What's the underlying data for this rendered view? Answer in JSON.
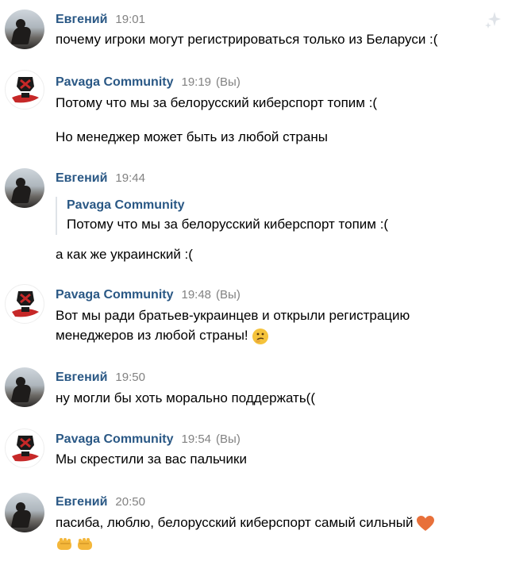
{
  "messages": [
    {
      "author": "Евгений",
      "time": "19:01",
      "owner_tag": "",
      "lines": [
        "почему игроки могут регистрироваться только из Беларуси :("
      ]
    },
    {
      "author": "Pavaga Community",
      "time": "19:19",
      "owner_tag": "(Вы)",
      "lines": [
        "Потому что мы за белорусский киберспорт топим :(",
        "Но менеджер может быть из любой страны"
      ]
    },
    {
      "author": "Евгений",
      "time": "19:44",
      "owner_tag": "",
      "quote": {
        "author": "Pavaga Community",
        "text": "Потому что мы за белорусский киберспорт топим :("
      },
      "lines": [
        "а как же украинский :("
      ]
    },
    {
      "author": "Pavaga Community",
      "time": "19:48",
      "owner_tag": "(Вы)",
      "lines": [
        "Вот мы ради братьев-украинцев и открыли регистрацию",
        "менеджеров из любой страны!"
      ]
    },
    {
      "author": "Евгений",
      "time": "19:50",
      "owner_tag": "",
      "lines": [
        "ну могли бы хоть морально поддержать(("
      ]
    },
    {
      "author": "Pavaga Community",
      "time": "19:54",
      "owner_tag": "(Вы)",
      "lines": [
        "Мы скрестили за вас пальчики"
      ]
    },
    {
      "author": "Евгений",
      "time": "20:50",
      "owner_tag": "",
      "lines": [
        "пасиба, люблю, белорусский киберспорт самый сильный"
      ]
    }
  ],
  "icons": {
    "sparkle": "sparkle-icon",
    "thinking": "thinking-face-emoji",
    "heart": "orange-heart-emoji",
    "punch": "fist-bump-emoji"
  },
  "colors": {
    "author": "#2a5885",
    "time": "#828282",
    "text": "#000000"
  }
}
